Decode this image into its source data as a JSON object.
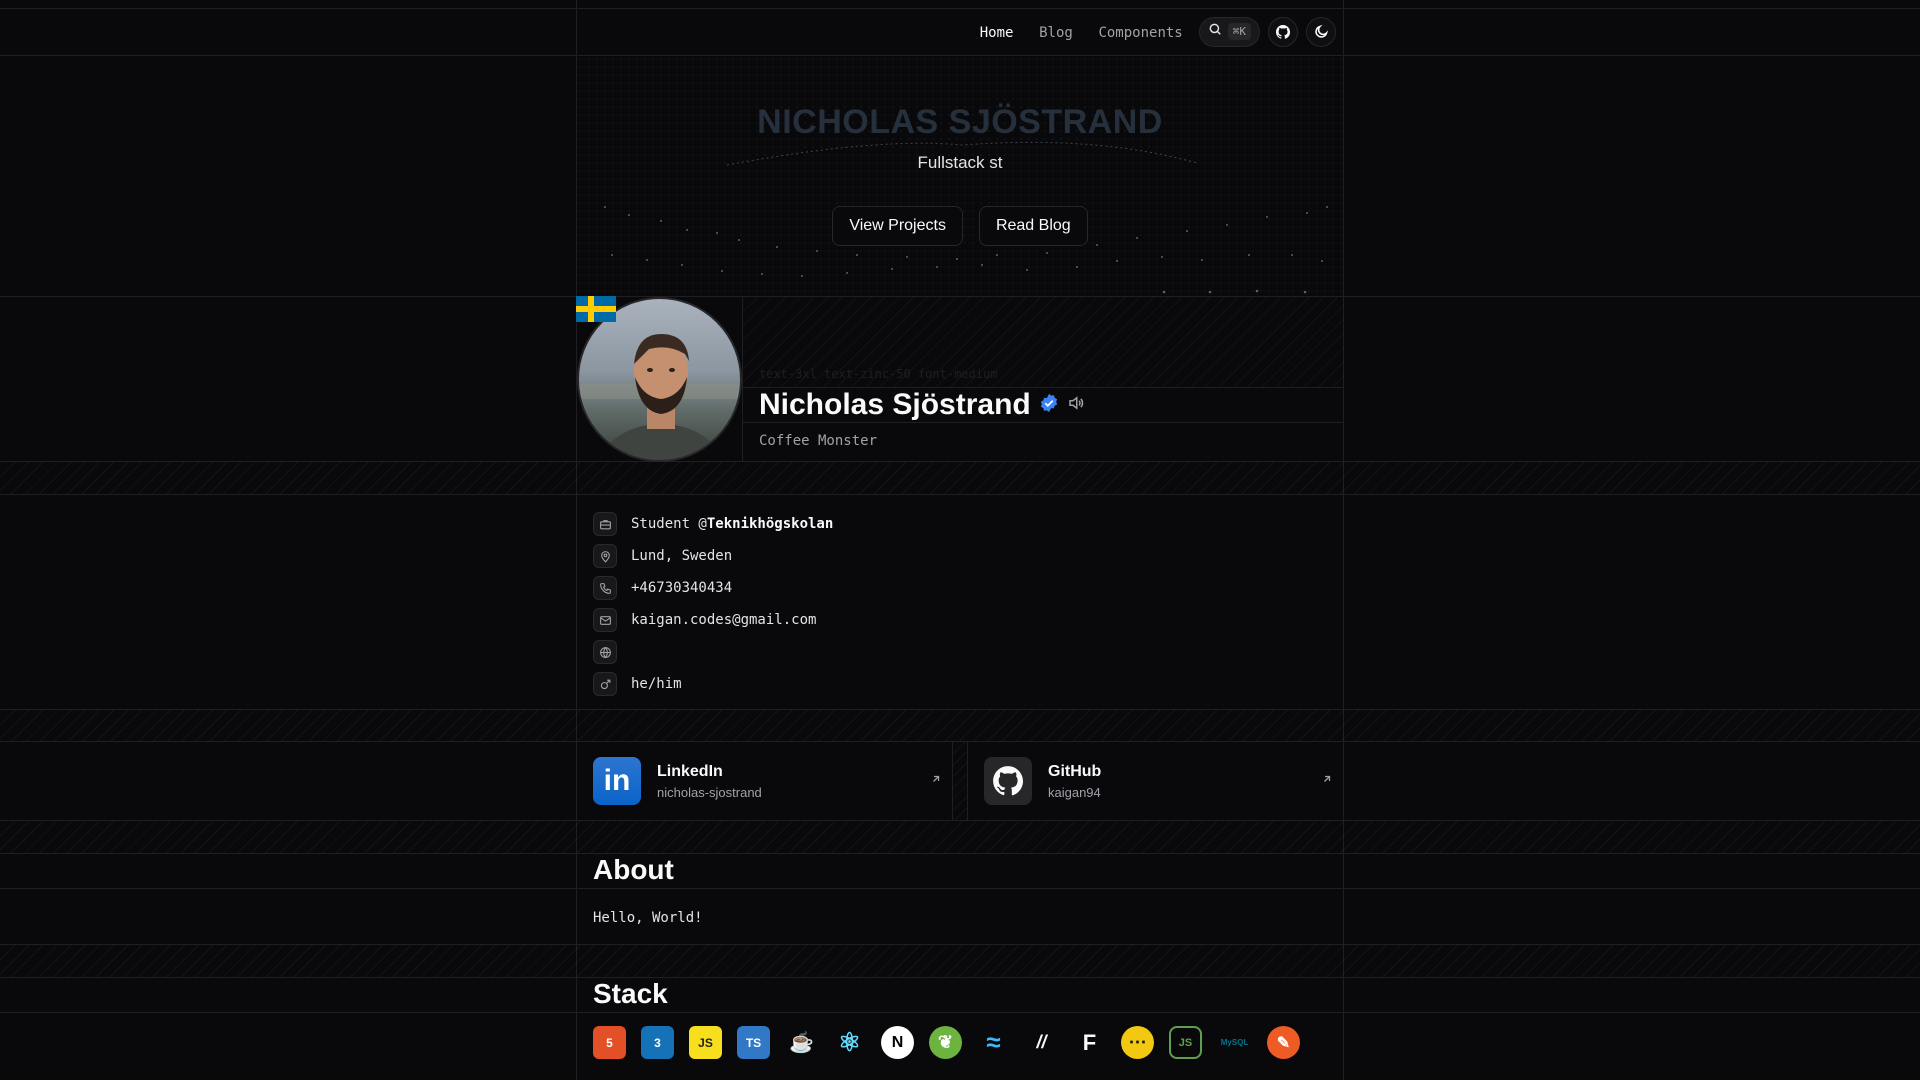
{
  "nav": {
    "items": [
      {
        "label": "Home",
        "active": true
      },
      {
        "label": "Blog",
        "active": false
      },
      {
        "label": "Components",
        "active": false
      }
    ],
    "search_shortcut": "⌘K"
  },
  "hero": {
    "title": "NICHOLAS SJÖSTRAND",
    "subtitle": "Fullstack st",
    "buttons": [
      "View Projects",
      "Read Blog"
    ]
  },
  "profile": {
    "flag": "sweden-flag",
    "ghost_text": "text-3xl text-zinc-50 font-medium",
    "name": "Nicholas Sjöstrand",
    "tagline": "Coffee Monster",
    "verified_color": "#3b82f6"
  },
  "info": {
    "work_prefix": "Student @",
    "work_org": "Teknikhögskolan",
    "location": "Lund, Sweden",
    "phone": "+46730340434",
    "email": "kaigan.codes@gmail.com",
    "website": "",
    "pronouns": "he/him"
  },
  "social": [
    {
      "title": "LinkedIn",
      "handle": "nicholas-sjostrand",
      "icon": "linkedin-icon"
    },
    {
      "title": "GitHub",
      "handle": "kaigan94",
      "icon": "github-icon"
    }
  ],
  "about": {
    "heading": "About",
    "text": "Hello, World!"
  },
  "stack": {
    "heading": "Stack",
    "items": [
      {
        "name": "html5",
        "label": "5",
        "color": "#e34f26"
      },
      {
        "name": "css3",
        "label": "3",
        "color": "#1572b6"
      },
      {
        "name": "javascript",
        "label": "JS",
        "color": "#f7df1e"
      },
      {
        "name": "typescript",
        "label": "TS",
        "color": "#3178c6"
      },
      {
        "name": "java",
        "label": "☕",
        "color": "#09090b"
      },
      {
        "name": "react",
        "label": "⚛",
        "color": "#09090b"
      },
      {
        "name": "nextjs",
        "label": "N",
        "color": "#ffffff"
      },
      {
        "name": "spring",
        "label": "❦",
        "color": "#6db33f"
      },
      {
        "name": "tailwindcss",
        "label": "≈",
        "color": "#09090b"
      },
      {
        "name": "shadcn",
        "label": "//",
        "color": "#09090b"
      },
      {
        "name": "figma",
        "label": "F",
        "color": "#09090b"
      },
      {
        "name": "swagger",
        "label": "⋯",
        "color": "#f2c811"
      },
      {
        "name": "nodejs",
        "label": "JS",
        "color": "#09090b"
      },
      {
        "name": "mysql",
        "label": "MySQL",
        "color": "#09090b"
      },
      {
        "name": "postman",
        "label": "✎",
        "color": "#ef5b25"
      }
    ]
  }
}
